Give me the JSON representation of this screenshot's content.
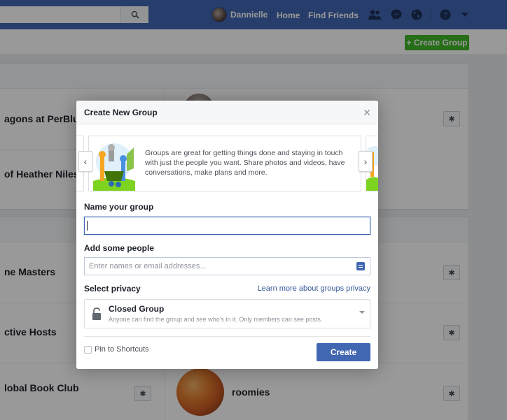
{
  "topbar": {
    "search": {
      "placeholder": "",
      "icon": "search-icon"
    },
    "user_name": "Dannielle",
    "nav": {
      "home": "Home",
      "find_friends": "Find Friends"
    },
    "icons": [
      "friend-requests-icon",
      "messenger-icon",
      "notifications-globe-icon",
      "help-icon",
      "dropdown-caret-icon"
    ],
    "color": "#4267b2"
  },
  "page": {
    "create_group_label": "+ Create Group",
    "groups": [
      {
        "name": "agons at PerBlu"
      },
      {
        "name": "of Heather Niles"
      },
      {
        "name": "ne Masters"
      },
      {
        "name": "ctive Hosts"
      },
      {
        "name": "lobal Book Club"
      },
      {
        "name": "roomies"
      }
    ],
    "gear_icon": "gear-icon"
  },
  "modal": {
    "title": "Create New Group",
    "close_icon": "close-icon",
    "carousel_text": "Groups are great for getting things done and staying in touch with just the people you want. Share photos and videos, have conversations, make plans and more.",
    "name_label": "Name your group",
    "name_value": "",
    "people_label": "Add some people",
    "people_placeholder": "Enter names or email addresses...",
    "privacy_label": "Select privacy",
    "privacy_link": "Learn more about groups privacy",
    "privacy_option": {
      "title": "Closed Group",
      "description": "Anyone can find the group and see who's in it. Only members can see posts."
    },
    "pin_label": "Pin to Shortcuts",
    "pin_checked": false,
    "create_label": "Create"
  }
}
